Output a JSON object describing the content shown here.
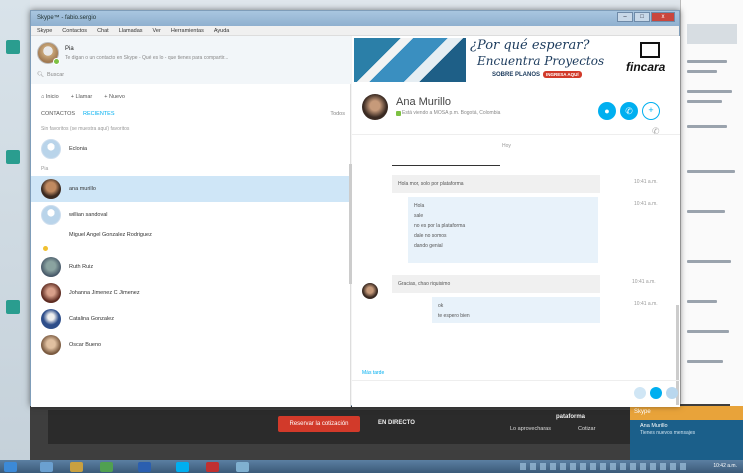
{
  "window": {
    "title": "Skype™ - fabio.sergio",
    "ctrl_min": "–",
    "ctrl_max": "□",
    "ctrl_close": "x"
  },
  "menu": [
    "Skype",
    "Contactos",
    "Chat",
    "Llamadas",
    "Ver",
    "Herramientas",
    "Ayuda"
  ],
  "profile": {
    "name": "Pia",
    "mood": "Te digan o un contacto en Skype - Qué es lo - que tienes para compartir...",
    "search_placeholder": "Buscar"
  },
  "toolbar": {
    "home": "Inicio",
    "call": "Llamar",
    "new": "Nuevo"
  },
  "tabs": {
    "contacts": "CONTACTOS",
    "recent": "RECIENTES",
    "sort": "Todos"
  },
  "sections": {
    "favorites": "Sin favoritos (se muestra aquí) favoritos",
    "all": "Pia"
  },
  "contacts": [
    {
      "name": "Echo / Sound Test Service",
      "display": "Eclonia"
    },
    {
      "name": "ana murillo",
      "display": "ana murillo"
    },
    {
      "name": "willian sandoval",
      "display": "willian sandoval"
    },
    {
      "name": "Miguel Angel Gonzalez Rodriguez",
      "display": "Miguel Angel Gonzalez Rodriguez"
    },
    {
      "name": "Ruth Ruiz",
      "display": "Ruth Ruiz"
    },
    {
      "name": "Johanna Jimenez C Jimenez",
      "display": "Johanna Jimenez C Jimenez"
    },
    {
      "name": "Catalina Gonzalez",
      "display": "Catalina Gonzalez"
    },
    {
      "name": "Oscar Bueno",
      "display": "Oscar Bueno"
    }
  ],
  "ad": {
    "line1": "¿Por qué esperar?",
    "line2": "Encuentra Proyectos",
    "line3": "SOBRE PLANOS",
    "badge": "INGRESA AQUÍ",
    "brand": "fincara"
  },
  "conversation": {
    "name": "Ana Murillo",
    "status": "Está viendo a MOSA p.m. Bogotá, Colombia",
    "call_icon": "✆",
    "video_icon": "●",
    "add_icon": "+",
    "phone_hint": "✆"
  },
  "messages": {
    "day_label": "Hoy",
    "m1": "Hola mor, solo por plataforma",
    "m1_time": "10:41 a.m.",
    "m2": [
      "Hola",
      "sale",
      "no es por la plataforma",
      "dale no somos",
      "dando genial"
    ],
    "m2_time": "10:41 a.m.",
    "m3": "Gracias, chao riquisimo",
    "m3_time": "10:41 a.m.",
    "m4": [
      "ok",
      "te espero bien"
    ],
    "m4_time": "10:41 a.m.",
    "more": "Más tarde"
  },
  "promo": {
    "button": "Reservar la cotización",
    "label": "EN DIRECTO",
    "right1": "pataforma",
    "right2": "Lo aprovecharas",
    "right3": "Cotizar"
  },
  "notification": {
    "head": "Skype",
    "title": "Ana Murillo",
    "body": "Tienes nuevos mensajes"
  },
  "tray": {
    "time": "10:42 a.m."
  }
}
